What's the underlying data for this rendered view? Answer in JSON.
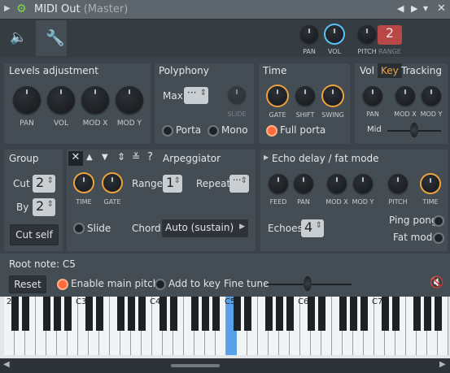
{
  "window": {
    "title": "MIDI Out",
    "subtitle": "(Master)"
  },
  "header_knobs": {
    "pan": "PAN",
    "vol": "VOL",
    "pitch": "PITCH",
    "range": "RANGE",
    "range_value": "2"
  },
  "levels": {
    "title": "Levels adjustment",
    "knobs": [
      "PAN",
      "VOL",
      "MOD X",
      "MOD Y"
    ]
  },
  "polyphony": {
    "title": "Polyphony",
    "max_label": "Max",
    "max_value": "···",
    "slide": "SLIDE",
    "porta": "Porta",
    "mono": "Mono"
  },
  "time": {
    "title": "Time",
    "gate": "GATE",
    "shift": "SHIFT",
    "swing": "SWING",
    "full_porta": "Full porta"
  },
  "tracking": {
    "vol": "Vol",
    "key": "Key",
    "tracking": "Tracking",
    "pan": "PAN",
    "modx": "MOD X",
    "mody": "MOD Y",
    "mid": "Mid"
  },
  "group": {
    "title": "Group",
    "cut": "Cut",
    "cut_value": "2",
    "by": "By",
    "by_value": "2",
    "cut_self": "Cut self"
  },
  "arp": {
    "title": "Arpeggiator",
    "time": "TIME",
    "gate": "GATE",
    "range": "Range",
    "range_value": "1",
    "repeat": "Repeat",
    "repeat_value": "···",
    "slide": "Slide",
    "chord": "Chord",
    "chord_value": "Auto (sustain)"
  },
  "echo": {
    "title": "Echo delay / fat mode",
    "feed": "FEED",
    "pan": "PAN",
    "modx": "MOD X",
    "mody": "MOD Y",
    "pitch": "PITCH",
    "time": "TIME",
    "echoes": "Echoes",
    "echoes_value": "4",
    "ping_pong": "Ping pong",
    "fat_mode": "Fat mode"
  },
  "root": {
    "title": "Root note: C5",
    "reset": "Reset",
    "enable_main_pitch": "Enable main pitch",
    "add_to_key": "Add to key",
    "fine_tune": "Fine tune"
  },
  "piano": {
    "labels": [
      "2",
      "C3",
      "C4",
      "C5",
      "C6",
      "C7"
    ],
    "highlight": "C5"
  },
  "colors": {
    "accent_orange": "#f2a33a",
    "accent_blue": "#56c8ff",
    "radio_on": "#ff6a3c",
    "key_highlight": "#5aa0e8"
  }
}
